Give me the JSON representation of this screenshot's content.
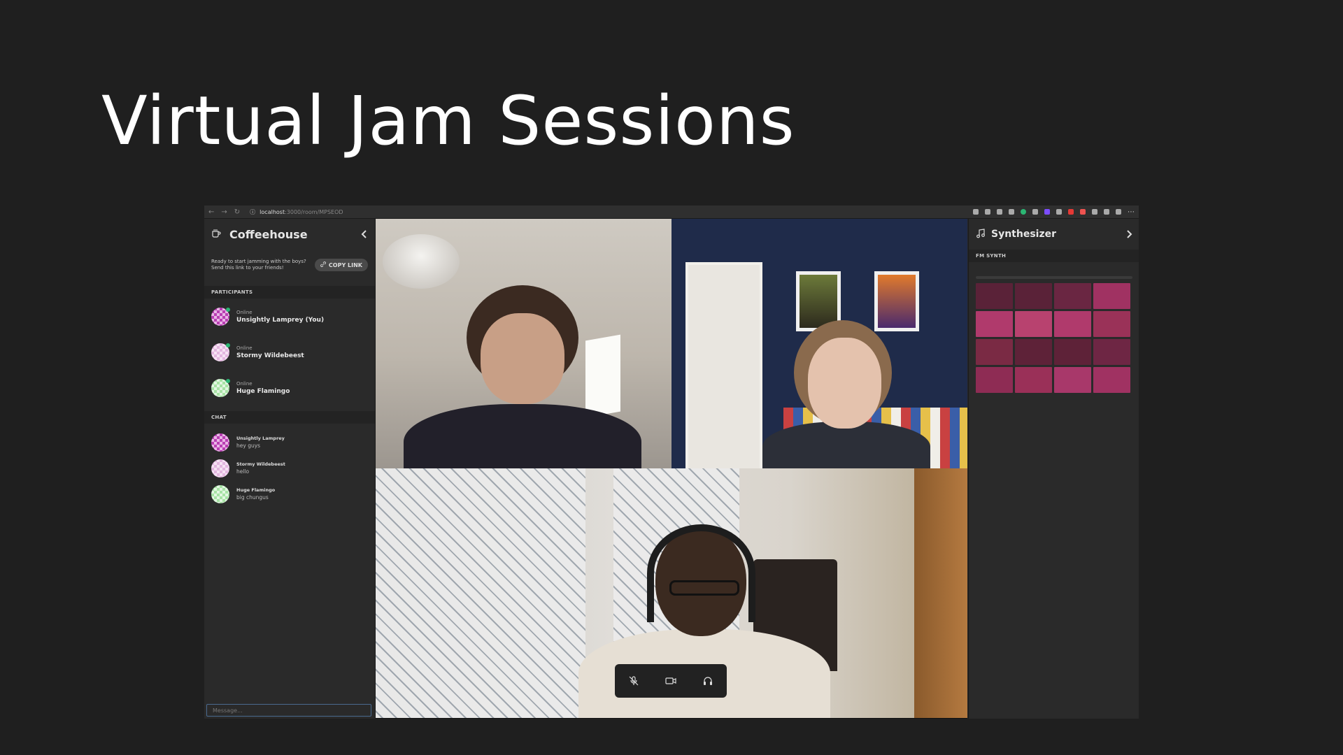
{
  "slide": {
    "title": "Virtual Jam Sessions"
  },
  "browser": {
    "url_host": "localhost",
    "url_path": ":3000/room/MPSEOD"
  },
  "sidebar": {
    "room_name": "Coffeehouse",
    "invite_text": "Ready to start jamming with the boys? Send this link to your friends!",
    "copy_link_label": "COPY LINK",
    "participants_label": "PARTICIPANTS",
    "participants": [
      {
        "status": "Online",
        "name": "Unsightly Lamprey (You)",
        "avatar": "purple"
      },
      {
        "status": "Online",
        "name": "Stormy Wildebeest",
        "avatar": "pink"
      },
      {
        "status": "Online",
        "name": "Huge Flamingo",
        "avatar": "green"
      }
    ],
    "chat_label": "CHAT",
    "chat": [
      {
        "author": "Unsightly Lamprey",
        "text": "hey guys",
        "avatar": "purple"
      },
      {
        "author": "Stormy Wildebeest",
        "text": "hello",
        "avatar": "pink"
      },
      {
        "author": "Huge Flamingo",
        "text": "big chungus",
        "avatar": "green"
      }
    ],
    "message_placeholder": "Message..."
  },
  "controls": {
    "icons": [
      "mic-off-icon",
      "camera-icon",
      "headphones-icon"
    ]
  },
  "synth": {
    "title": "Synthesizer",
    "section_label": "FM SYNTH",
    "pad_colors": [
      "#5a2238",
      "#5a2238",
      "#6a2642",
      "#a03262",
      "#b03a6c",
      "#b8426f",
      "#b03a6c",
      "#9a3258",
      "#7a2a44",
      "#5e2238",
      "#5e2238",
      "#6e2644",
      "#8e2c54",
      "#9a3058",
      "#a8386a",
      "#a03262"
    ]
  }
}
